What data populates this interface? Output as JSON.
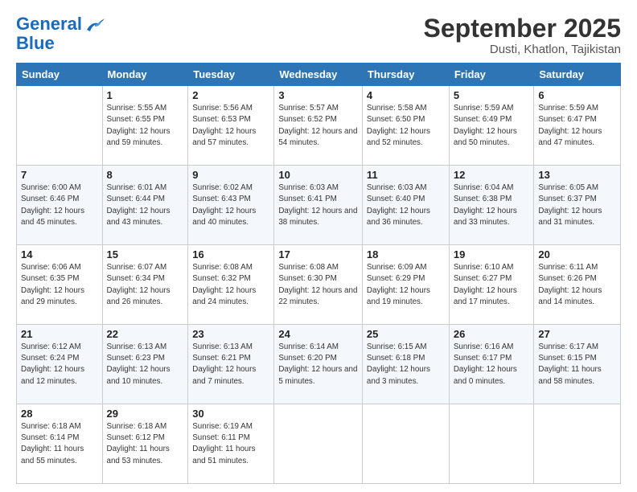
{
  "header": {
    "logo_line1": "General",
    "logo_line2": "Blue",
    "title": "September 2025",
    "subtitle": "Dusti, Khatlon, Tajikistan"
  },
  "weekdays": [
    "Sunday",
    "Monday",
    "Tuesday",
    "Wednesday",
    "Thursday",
    "Friday",
    "Saturday"
  ],
  "weeks": [
    [
      {
        "day": "",
        "sunrise": "",
        "sunset": "",
        "daylight": ""
      },
      {
        "day": "1",
        "sunrise": "Sunrise: 5:55 AM",
        "sunset": "Sunset: 6:55 PM",
        "daylight": "Daylight: 12 hours and 59 minutes."
      },
      {
        "day": "2",
        "sunrise": "Sunrise: 5:56 AM",
        "sunset": "Sunset: 6:53 PM",
        "daylight": "Daylight: 12 hours and 57 minutes."
      },
      {
        "day": "3",
        "sunrise": "Sunrise: 5:57 AM",
        "sunset": "Sunset: 6:52 PM",
        "daylight": "Daylight: 12 hours and 54 minutes."
      },
      {
        "day": "4",
        "sunrise": "Sunrise: 5:58 AM",
        "sunset": "Sunset: 6:50 PM",
        "daylight": "Daylight: 12 hours and 52 minutes."
      },
      {
        "day": "5",
        "sunrise": "Sunrise: 5:59 AM",
        "sunset": "Sunset: 6:49 PM",
        "daylight": "Daylight: 12 hours and 50 minutes."
      },
      {
        "day": "6",
        "sunrise": "Sunrise: 5:59 AM",
        "sunset": "Sunset: 6:47 PM",
        "daylight": "Daylight: 12 hours and 47 minutes."
      }
    ],
    [
      {
        "day": "7",
        "sunrise": "Sunrise: 6:00 AM",
        "sunset": "Sunset: 6:46 PM",
        "daylight": "Daylight: 12 hours and 45 minutes."
      },
      {
        "day": "8",
        "sunrise": "Sunrise: 6:01 AM",
        "sunset": "Sunset: 6:44 PM",
        "daylight": "Daylight: 12 hours and 43 minutes."
      },
      {
        "day": "9",
        "sunrise": "Sunrise: 6:02 AM",
        "sunset": "Sunset: 6:43 PM",
        "daylight": "Daylight: 12 hours and 40 minutes."
      },
      {
        "day": "10",
        "sunrise": "Sunrise: 6:03 AM",
        "sunset": "Sunset: 6:41 PM",
        "daylight": "Daylight: 12 hours and 38 minutes."
      },
      {
        "day": "11",
        "sunrise": "Sunrise: 6:03 AM",
        "sunset": "Sunset: 6:40 PM",
        "daylight": "Daylight: 12 hours and 36 minutes."
      },
      {
        "day": "12",
        "sunrise": "Sunrise: 6:04 AM",
        "sunset": "Sunset: 6:38 PM",
        "daylight": "Daylight: 12 hours and 33 minutes."
      },
      {
        "day": "13",
        "sunrise": "Sunrise: 6:05 AM",
        "sunset": "Sunset: 6:37 PM",
        "daylight": "Daylight: 12 hours and 31 minutes."
      }
    ],
    [
      {
        "day": "14",
        "sunrise": "Sunrise: 6:06 AM",
        "sunset": "Sunset: 6:35 PM",
        "daylight": "Daylight: 12 hours and 29 minutes."
      },
      {
        "day": "15",
        "sunrise": "Sunrise: 6:07 AM",
        "sunset": "Sunset: 6:34 PM",
        "daylight": "Daylight: 12 hours and 26 minutes."
      },
      {
        "day": "16",
        "sunrise": "Sunrise: 6:08 AM",
        "sunset": "Sunset: 6:32 PM",
        "daylight": "Daylight: 12 hours and 24 minutes."
      },
      {
        "day": "17",
        "sunrise": "Sunrise: 6:08 AM",
        "sunset": "Sunset: 6:30 PM",
        "daylight": "Daylight: 12 hours and 22 minutes."
      },
      {
        "day": "18",
        "sunrise": "Sunrise: 6:09 AM",
        "sunset": "Sunset: 6:29 PM",
        "daylight": "Daylight: 12 hours and 19 minutes."
      },
      {
        "day": "19",
        "sunrise": "Sunrise: 6:10 AM",
        "sunset": "Sunset: 6:27 PM",
        "daylight": "Daylight: 12 hours and 17 minutes."
      },
      {
        "day": "20",
        "sunrise": "Sunrise: 6:11 AM",
        "sunset": "Sunset: 6:26 PM",
        "daylight": "Daylight: 12 hours and 14 minutes."
      }
    ],
    [
      {
        "day": "21",
        "sunrise": "Sunrise: 6:12 AM",
        "sunset": "Sunset: 6:24 PM",
        "daylight": "Daylight: 12 hours and 12 minutes."
      },
      {
        "day": "22",
        "sunrise": "Sunrise: 6:13 AM",
        "sunset": "Sunset: 6:23 PM",
        "daylight": "Daylight: 12 hours and 10 minutes."
      },
      {
        "day": "23",
        "sunrise": "Sunrise: 6:13 AM",
        "sunset": "Sunset: 6:21 PM",
        "daylight": "Daylight: 12 hours and 7 minutes."
      },
      {
        "day": "24",
        "sunrise": "Sunrise: 6:14 AM",
        "sunset": "Sunset: 6:20 PM",
        "daylight": "Daylight: 12 hours and 5 minutes."
      },
      {
        "day": "25",
        "sunrise": "Sunrise: 6:15 AM",
        "sunset": "Sunset: 6:18 PM",
        "daylight": "Daylight: 12 hours and 3 minutes."
      },
      {
        "day": "26",
        "sunrise": "Sunrise: 6:16 AM",
        "sunset": "Sunset: 6:17 PM",
        "daylight": "Daylight: 12 hours and 0 minutes."
      },
      {
        "day": "27",
        "sunrise": "Sunrise: 6:17 AM",
        "sunset": "Sunset: 6:15 PM",
        "daylight": "Daylight: 11 hours and 58 minutes."
      }
    ],
    [
      {
        "day": "28",
        "sunrise": "Sunrise: 6:18 AM",
        "sunset": "Sunset: 6:14 PM",
        "daylight": "Daylight: 11 hours and 55 minutes."
      },
      {
        "day": "29",
        "sunrise": "Sunrise: 6:18 AM",
        "sunset": "Sunset: 6:12 PM",
        "daylight": "Daylight: 11 hours and 53 minutes."
      },
      {
        "day": "30",
        "sunrise": "Sunrise: 6:19 AM",
        "sunset": "Sunset: 6:11 PM",
        "daylight": "Daylight: 11 hours and 51 minutes."
      },
      {
        "day": "",
        "sunrise": "",
        "sunset": "",
        "daylight": ""
      },
      {
        "day": "",
        "sunrise": "",
        "sunset": "",
        "daylight": ""
      },
      {
        "day": "",
        "sunrise": "",
        "sunset": "",
        "daylight": ""
      },
      {
        "day": "",
        "sunrise": "",
        "sunset": "",
        "daylight": ""
      }
    ]
  ]
}
